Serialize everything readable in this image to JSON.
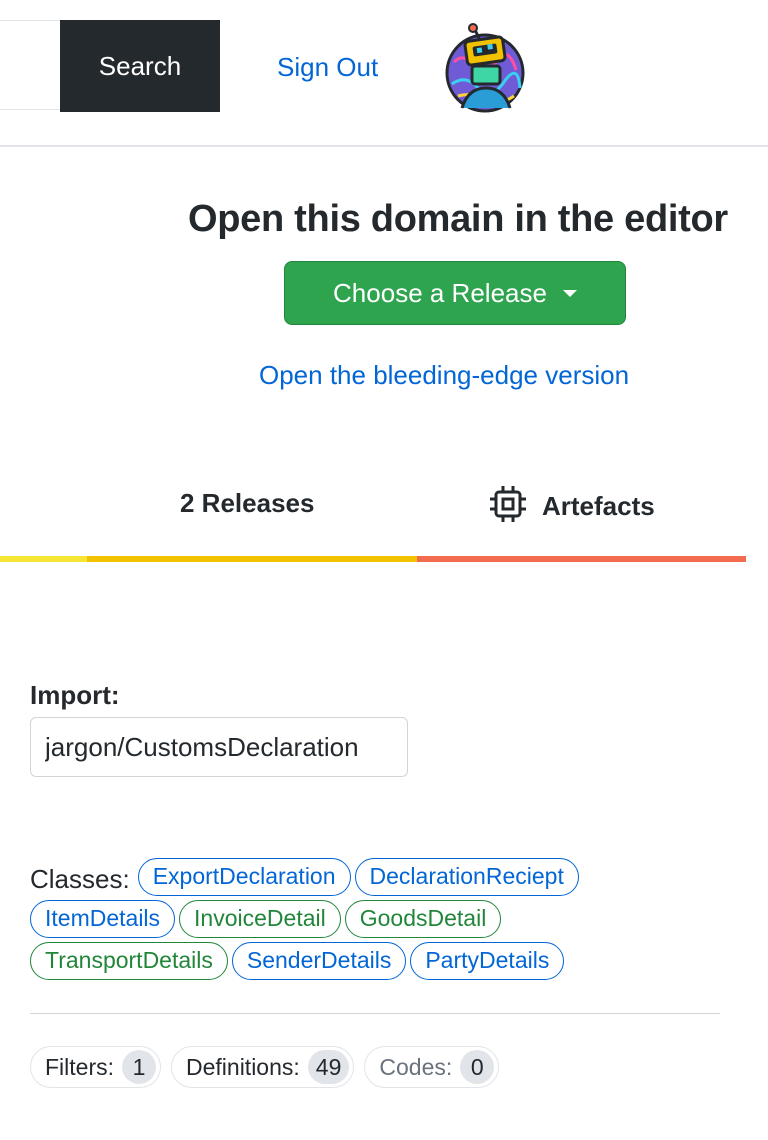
{
  "header": {
    "search_label": "Search",
    "signout_label": "Sign Out",
    "avatar_icon": "robot-avatar-icon"
  },
  "editor": {
    "title": "Open this domain in the editor",
    "release_button_label": "Choose a Release",
    "bleeding_edge_link": "Open the bleeding-edge version"
  },
  "tabs": [
    {
      "label": "2 Releases"
    },
    {
      "label": "Artefacts",
      "icon": "cpu-chip-icon"
    }
  ],
  "import": {
    "label": "Import:",
    "value": "jargon/CustomsDeclaration"
  },
  "classes": {
    "label": "Classes:",
    "items": [
      {
        "label": "ExportDeclaration",
        "color": "#0366d6"
      },
      {
        "label": "DeclarationReciept",
        "color": "#0366d6"
      },
      {
        "label": "ItemDetails",
        "color": "#0366d6"
      },
      {
        "label": "InvoiceDetail",
        "color": "#22863a"
      },
      {
        "label": "GoodsDetail",
        "color": "#22863a"
      },
      {
        "label": "TransportDetails",
        "color": "#22863a"
      },
      {
        "label": "SenderDetails",
        "color": "#0366d6"
      },
      {
        "label": "PartyDetails",
        "color": "#0366d6"
      }
    ]
  },
  "counters": [
    {
      "label": "Filters:",
      "count": "1"
    },
    {
      "label": "Definitions:",
      "count": "49"
    },
    {
      "label": "Codes:",
      "count": "0"
    }
  ],
  "colors": {
    "link_blue": "#0366d6",
    "primary_green": "#2ea44f",
    "dark": "#24292e",
    "tab_yellow": "#f2c200",
    "tab_orange": "#f26b4f"
  }
}
